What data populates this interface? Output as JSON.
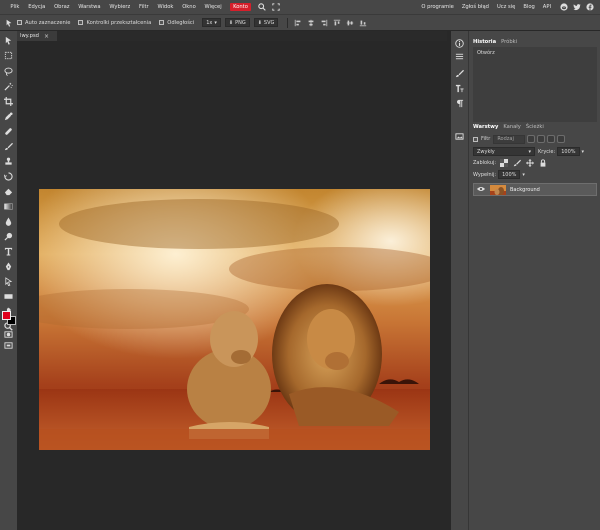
{
  "menubar": {
    "items": [
      "Plik",
      "Edycja",
      "Obraz",
      "Warstwa",
      "Wybierz",
      "Filtr",
      "Widok",
      "Okno",
      "Więcej"
    ],
    "konto": "Konto",
    "right_items": [
      "O programie",
      "Zgłoś błąd",
      "Ucz się",
      "Blog",
      "API"
    ],
    "konto_color": "#d61f2b",
    "social_icons": [
      "reddit-icon",
      "twitter-icon",
      "facebook-icon"
    ]
  },
  "options": {
    "auto_select": "Auto zaznaczenie",
    "transform": "Kontrolki przekształcenia",
    "distances": "Odległości",
    "zoom": "1x",
    "png": "PNG",
    "svg": "SVG"
  },
  "document": {
    "tab_name": "lwy.psd"
  },
  "history": {
    "tabs": [
      "Historia",
      "Próbki"
    ],
    "entries": [
      "Otwórz"
    ]
  },
  "layers": {
    "tabs": [
      "Warstwy",
      "Kanały",
      "Ścieżki"
    ],
    "filter_label": "Filtr",
    "filter_kind": "Rodzaj",
    "blend_mode": "Zwykły",
    "opacity_label": "Krycie:",
    "opacity_value": "100%",
    "lock_label": "Zablokuj:",
    "fill_label": "Wypełnij:",
    "fill_value": "100%",
    "items": [
      {
        "name": "Background"
      }
    ]
  },
  "colors": {
    "foreground": "#e0001b",
    "background": "#000000"
  }
}
